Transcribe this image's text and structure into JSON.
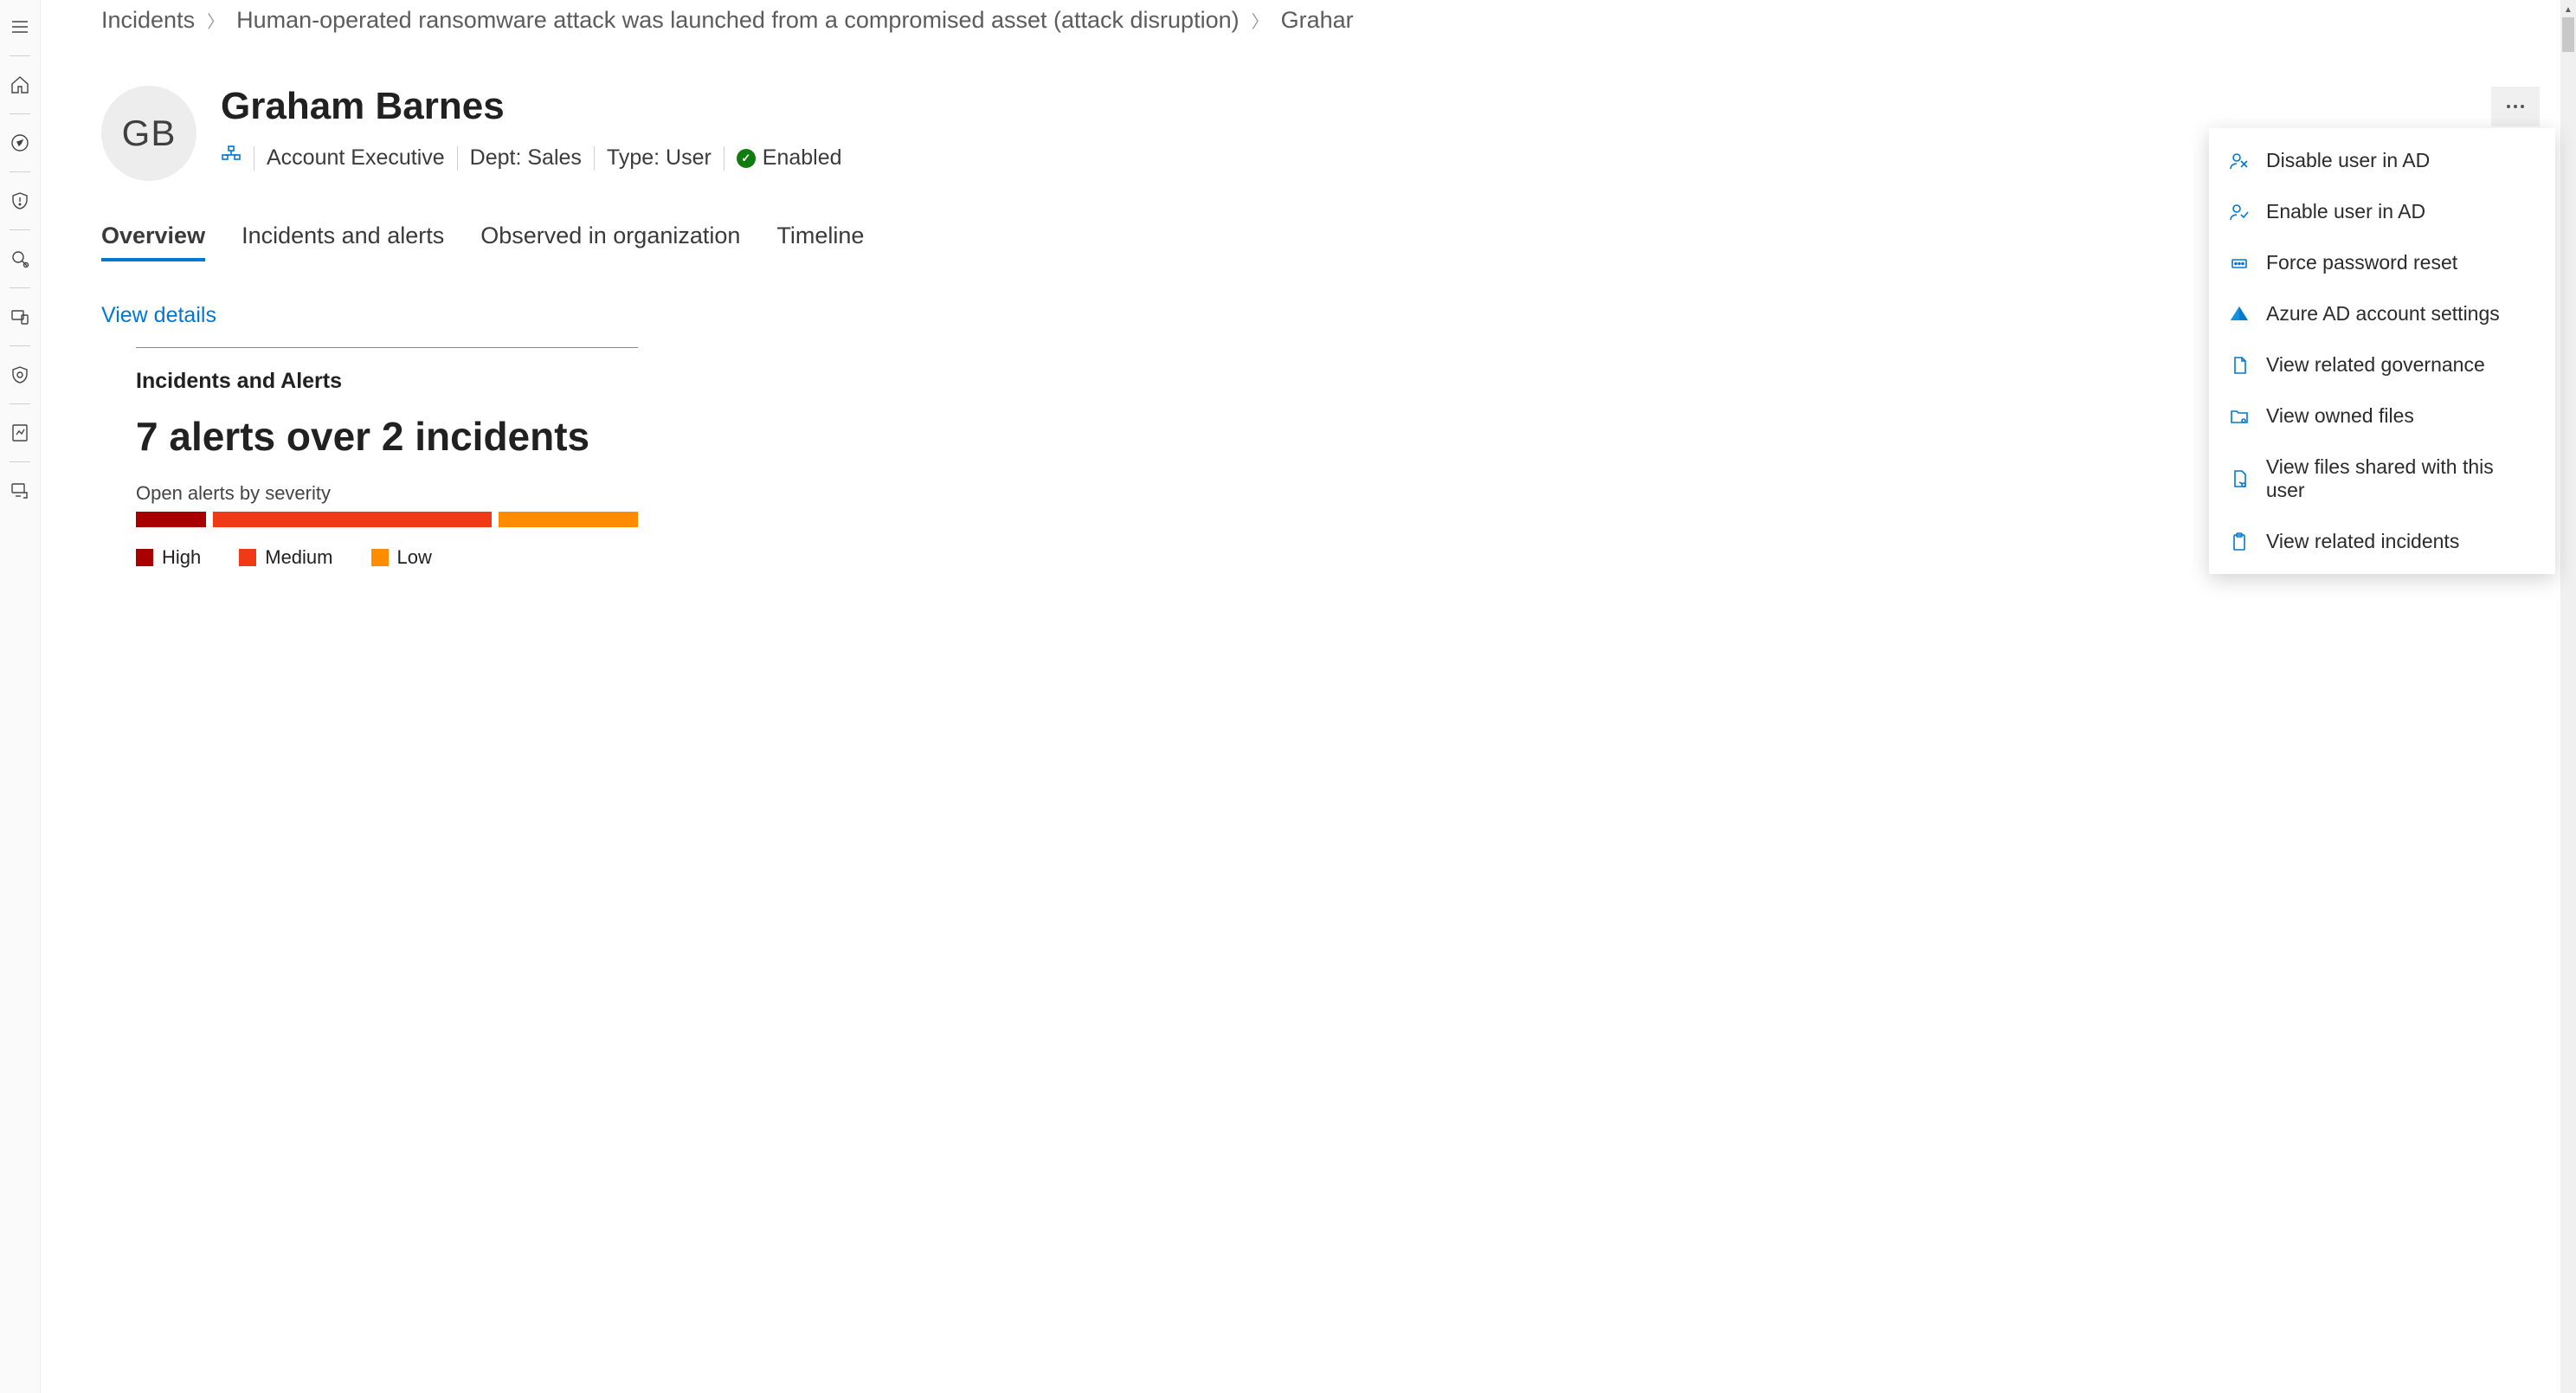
{
  "breadcrumb": {
    "root": "Incidents",
    "incident": "Human-operated ransomware attack was launched from a compromised asset (attack disruption)",
    "leaf": "Grahar"
  },
  "user": {
    "initials": "GB",
    "name": "Graham Barnes",
    "title": "Account Executive",
    "dept": "Dept: Sales",
    "type": "Type: User",
    "status": "Enabled"
  },
  "tabs": {
    "overview": "Overview",
    "incidents": "Incidents and alerts",
    "observed": "Observed in organization",
    "timeline": "Timeline"
  },
  "overview": {
    "view_details": "View details",
    "section_title": "Incidents and Alerts",
    "stat": "7 alerts over 2 incidents",
    "chart_label": "Open alerts by severity",
    "legend": {
      "high": "High",
      "medium": "Medium",
      "low": "Low"
    }
  },
  "menu": {
    "disable": "Disable user in AD",
    "enable": "Enable user in AD",
    "reset": "Force password reset",
    "azure": "Azure AD account settings",
    "governance": "View related governance",
    "owned": "View owned files",
    "shared": "View files shared with this user",
    "incidents": "View related incidents"
  },
  "colors": {
    "high": "#a80000",
    "medium": "#f03a17",
    "low": "#ff8c00",
    "accent": "#0078d4",
    "ok": "#107c10"
  },
  "chart_data": {
    "type": "bar",
    "title": "Open alerts by severity",
    "categories": [
      "High",
      "Medium",
      "Low"
    ],
    "values": [
      1,
      4,
      2
    ],
    "colors": [
      "#a80000",
      "#f03a17",
      "#ff8c00"
    ],
    "total_alerts": 7,
    "total_incidents": 2
  }
}
